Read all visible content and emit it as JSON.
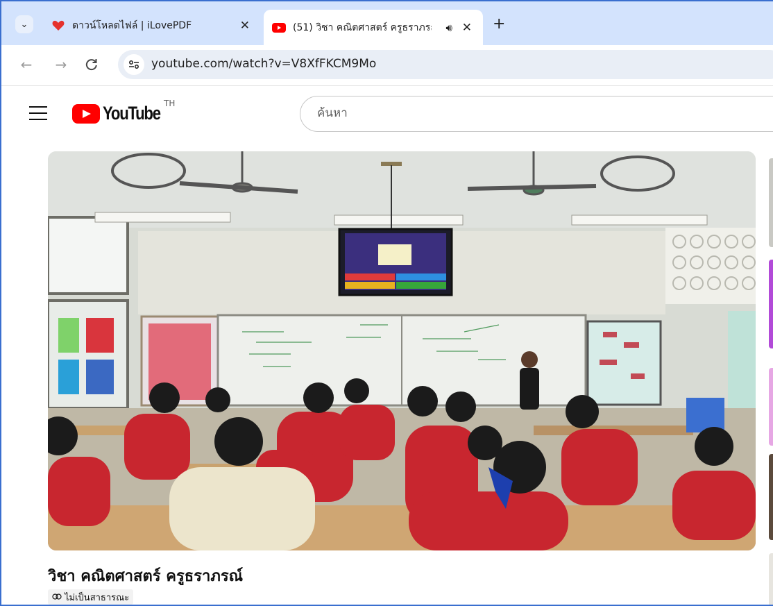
{
  "browser": {
    "tabs": [
      {
        "title": "ดาวน์โหลดไฟล์ | iLovePDF",
        "favicon": "heart-icon",
        "active": false
      },
      {
        "title": "(51) วิชา คณิตศาสตร์ ครูธราภรณ์",
        "favicon": "youtube-icon",
        "active": true,
        "audio": true
      }
    ],
    "url": "youtube.com/watch?v=V8XfFKCM9Mo",
    "accent": "#d3e3fd"
  },
  "youtube": {
    "logo_text": "YouTube",
    "region": "TH",
    "search_placeholder": "ค้นหา"
  },
  "video": {
    "title": "วิชา คณิตศาสตร์ ครูธราภรณ์",
    "privacy": "ไม่เป็นสาธารณะ",
    "privacy_icon": "link-icon"
  }
}
